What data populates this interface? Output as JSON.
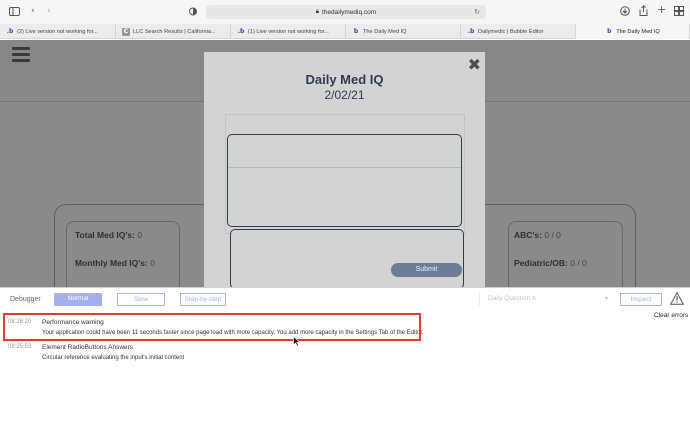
{
  "browser": {
    "url": "thedailymediq.com",
    "tabs": [
      {
        "title": "(2) Live version not working for...",
        "icon": "bubble-b"
      },
      {
        "title": "LLC Search Results | California...",
        "icon": "gray-square"
      },
      {
        "title": "(1) Live version not working for...",
        "icon": "bubble-b"
      },
      {
        "title": "The Daily Med IQ",
        "icon": "dailymed-b"
      },
      {
        "title": "Dailymedic | Bubble Editor",
        "icon": "bubble-b"
      },
      {
        "title": "The Daily Med IQ",
        "icon": "dailymed-b"
      }
    ]
  },
  "page": {
    "stats": {
      "total_label": "Total Med IQ's:",
      "total_value": "0",
      "monthly_label": "Monthly Med IQ's:",
      "monthly_value": "0",
      "abc_label": "ABC's:",
      "abc_value": "0 / 0",
      "peds_label": "Pediatric/OB:",
      "peds_value": "0 / 0"
    }
  },
  "modal": {
    "title": "Daily Med IQ",
    "date": "2/02/21",
    "submit_label": "Submit"
  },
  "debugger": {
    "label": "Debugger",
    "modes": [
      "Normal",
      "Slow",
      "Step-by-step"
    ],
    "active_mode": "Normal",
    "element_select": "Daily Question A",
    "inspect_label": "Inspect",
    "clear_label": "Clear errors",
    "logs": [
      {
        "time": "08:26:20",
        "title": "Performance warning",
        "detail": "Your application could have been 11 seconds faster since page load with more capacity. You add more capacity in the Settings Tab of the Editor."
      },
      {
        "time": "08:25:53",
        "title": "Element RadioButtons Answers",
        "detail": "Circular reference evaluating the input's initial content"
      }
    ]
  },
  "colors": {
    "highlight": "#e23a2f",
    "accent": "#a5b0ea",
    "modal_text": "#2e3b52"
  }
}
